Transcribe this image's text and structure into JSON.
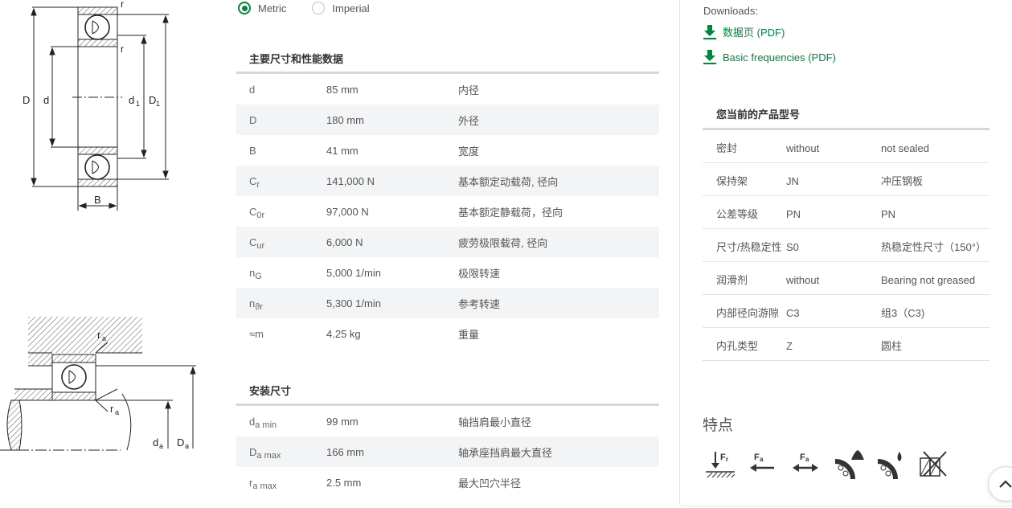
{
  "drawings": {
    "bearing": {
      "labels": {
        "D": "D",
        "d": "d",
        "d1": "d",
        "d1_sub": "1",
        "D1": "D",
        "D1_sub": "1",
        "B": "B",
        "r_top": "r",
        "r_mid": "r"
      }
    },
    "mounting": {
      "labels": {
        "ra_top": "r",
        "ra_top_sub": "a",
        "ra_bottom": "r",
        "ra_bottom_sub": "a",
        "da": "d",
        "da_sub": "a",
        "Da": "D",
        "Da_sub": "a"
      }
    }
  },
  "units": {
    "options": [
      {
        "label": "Metric",
        "selected": true
      },
      {
        "label": "Imperial",
        "selected": false
      }
    ]
  },
  "main_dimensions": {
    "title": "主要尺寸和性能数据",
    "rows": [
      {
        "sym": "d",
        "sub": "",
        "value": "85 mm",
        "desc": "内径"
      },
      {
        "sym": "D",
        "sub": "",
        "value": "180 mm",
        "desc": "外径"
      },
      {
        "sym": "B",
        "sub": "",
        "value": "41 mm",
        "desc": "宽度"
      },
      {
        "sym": "C",
        "sub": "r",
        "value": "141,000 N",
        "desc": "基本额定动载荷, 径向"
      },
      {
        "sym": "C",
        "sub": "0r",
        "value": "97,000 N",
        "desc": "基本额定静载荷，径向"
      },
      {
        "sym": "C",
        "sub": "ur",
        "value": "6,000 N",
        "desc": "疲劳极限载荷, 径向"
      },
      {
        "sym": "n",
        "sub": "G",
        "value": "5,000 1/min",
        "desc": "极限转速"
      },
      {
        "sym": "n",
        "sub": "ϑr",
        "value": "5,300 1/min",
        "desc": "参考转速"
      },
      {
        "sym": "≈m",
        "sub": "",
        "value": "4.25 kg",
        "desc": "重量"
      }
    ]
  },
  "mounting_dimensions": {
    "title": "安装尺寸",
    "rows": [
      {
        "sym": "d",
        "sub": "a min",
        "value": "99 mm",
        "desc": "轴挡肩最小直径"
      },
      {
        "sym": "D",
        "sub": "a max",
        "value": "166 mm",
        "desc": "轴承座挡肩最大直径"
      },
      {
        "sym": "r",
        "sub": "a max",
        "value": "2.5 mm",
        "desc": "最大凹穴半径"
      }
    ]
  },
  "downloads": {
    "label": "Downloads:",
    "links": [
      {
        "label": "数据页 (PDF)"
      },
      {
        "label": "Basic frequencies (PDF)"
      }
    ]
  },
  "current_product": {
    "title": "您当前的产品型号",
    "rows": [
      {
        "k": "密封",
        "code": "without",
        "v": "not sealed"
      },
      {
        "k": "保持架",
        "code": "JN",
        "v": "冲压钢板"
      },
      {
        "k": "公差等级",
        "code": "PN",
        "v": "PN"
      },
      {
        "k": "尺寸/热稳定性",
        "code": "S0",
        "v": "热稳定性尺寸（150°）"
      },
      {
        "k": "润滑剂",
        "code": "without",
        "v": "Bearing not greased"
      },
      {
        "k": "内部径向游隙",
        "code": "C3",
        "v": "组3（C3)"
      },
      {
        "k": "内孔类型",
        "code": "Z",
        "v": "圆柱"
      }
    ]
  },
  "features": {
    "title": "特点",
    "icons": [
      {
        "name": "radial-load-icon",
        "label": "F",
        "sub": "r"
      },
      {
        "name": "axial-load-one-direction-icon",
        "label": "F",
        "sub": "a"
      },
      {
        "name": "axial-load-both-directions-icon",
        "label": "F",
        "sub": "a"
      },
      {
        "name": "oil-lubrication-icon"
      },
      {
        "name": "grease-lubrication-icon"
      },
      {
        "name": "not-separable-icon"
      }
    ]
  },
  "colors": {
    "accent": "#00893d",
    "row_alt": "#f3f4f5",
    "table_border": "#d4d8dc"
  }
}
